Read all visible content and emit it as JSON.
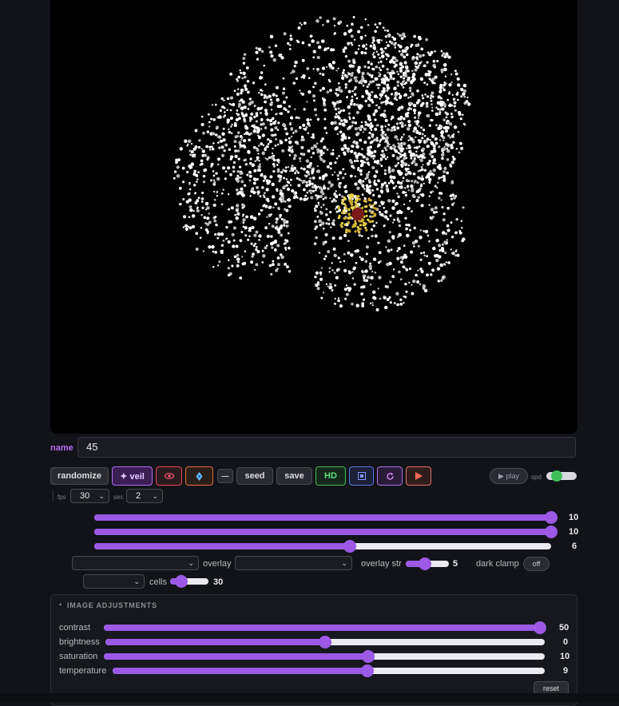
{
  "name_field": {
    "label": "name",
    "value": "45"
  },
  "toolbar": {
    "randomize": "randomize",
    "veil": "✦ veil",
    "eye_icon": "eye-icon",
    "drop_icon": "drop-icon",
    "dash": "—",
    "seed": "seed",
    "save": "save",
    "hd": "HD",
    "frame_icon": "frame-icon",
    "refresh_icon": "refresh-icon",
    "record_icon": "play-triangle-icon"
  },
  "playback": {
    "play": "▶ play",
    "spd": "spd",
    "spd_on": true
  },
  "fps": {
    "label": "fps",
    "value": "30",
    "sec_label": "sec",
    "sec_value": "2"
  },
  "sliders_top": [
    {
      "value": "10",
      "level": 1.0
    },
    {
      "value": "10",
      "level": 1.0
    },
    {
      "value": "6",
      "level": 0.56
    }
  ],
  "overlay": {
    "select1_value": "",
    "label": "overlay",
    "select2_value": "",
    "str_label": "overlay str",
    "str_value": "5",
    "str_level": 0.45,
    "dark_clamp_label": "dark clamp",
    "dark_clamp_state": "off"
  },
  "cells": {
    "select_value": "",
    "label": "cells",
    "value": "30",
    "level": 0.3
  },
  "image_adjustments": {
    "bullet": "•",
    "title": "IMAGE ADJUSTMENTS",
    "rows": [
      {
        "label": "contrast",
        "value": "50",
        "level": 1.0
      },
      {
        "label": "brightness",
        "value": "0",
        "level": 0.5
      },
      {
        "label": "saturation",
        "value": "10",
        "level": 0.6
      },
      {
        "label": "temperature",
        "value": "9",
        "level": 0.59
      }
    ],
    "reset": "reset"
  },
  "colors": {
    "accent": "#9b59e6",
    "name_label": "#b66df0",
    "toggle_on": "#3fbf5a"
  }
}
